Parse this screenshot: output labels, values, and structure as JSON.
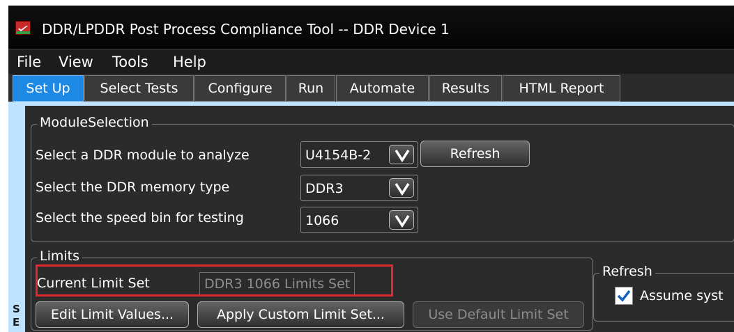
{
  "window": {
    "title": "DDR/LPDDR Post Process Compliance Tool -- DDR Device 1",
    "app_icon": "app-logo-icon"
  },
  "menu": [
    "File",
    "View",
    "Tools",
    "Help"
  ],
  "tabs": [
    "Set Up",
    "Select Tests",
    "Configure",
    "Run",
    "Automate",
    "Results",
    "HTML Report"
  ],
  "active_tab": "Set Up",
  "side_tab_letters": [
    "S",
    "E"
  ],
  "module_selection": {
    "legend": "ModuleSelection",
    "module_label": "Select a DDR module to analyze",
    "module_value": "U4154B-2",
    "refresh_button": "Refresh",
    "memory_type_label": "Select the DDR memory type",
    "memory_type_value": "DDR3",
    "speed_bin_label": "Select the speed bin for testing",
    "speed_bin_value": "1066",
    "dropdown_icon": "chevron-down-icon"
  },
  "limits": {
    "legend": "Limits",
    "current_limit_label": "Current Limit Set",
    "current_limit_value": "DDR3 1066 Limits Set",
    "edit_button": "Edit Limit Values...",
    "apply_button": "Apply Custom Limit Set...",
    "default_button": "Use Default Limit Set"
  },
  "refresh_group": {
    "legend": "Refresh",
    "checkbox_label": "Assume syst",
    "checked": true
  },
  "colors": {
    "active_tab": "#1e88e5",
    "highlight_box": "#e0282e",
    "background": "#2b2b2b"
  }
}
